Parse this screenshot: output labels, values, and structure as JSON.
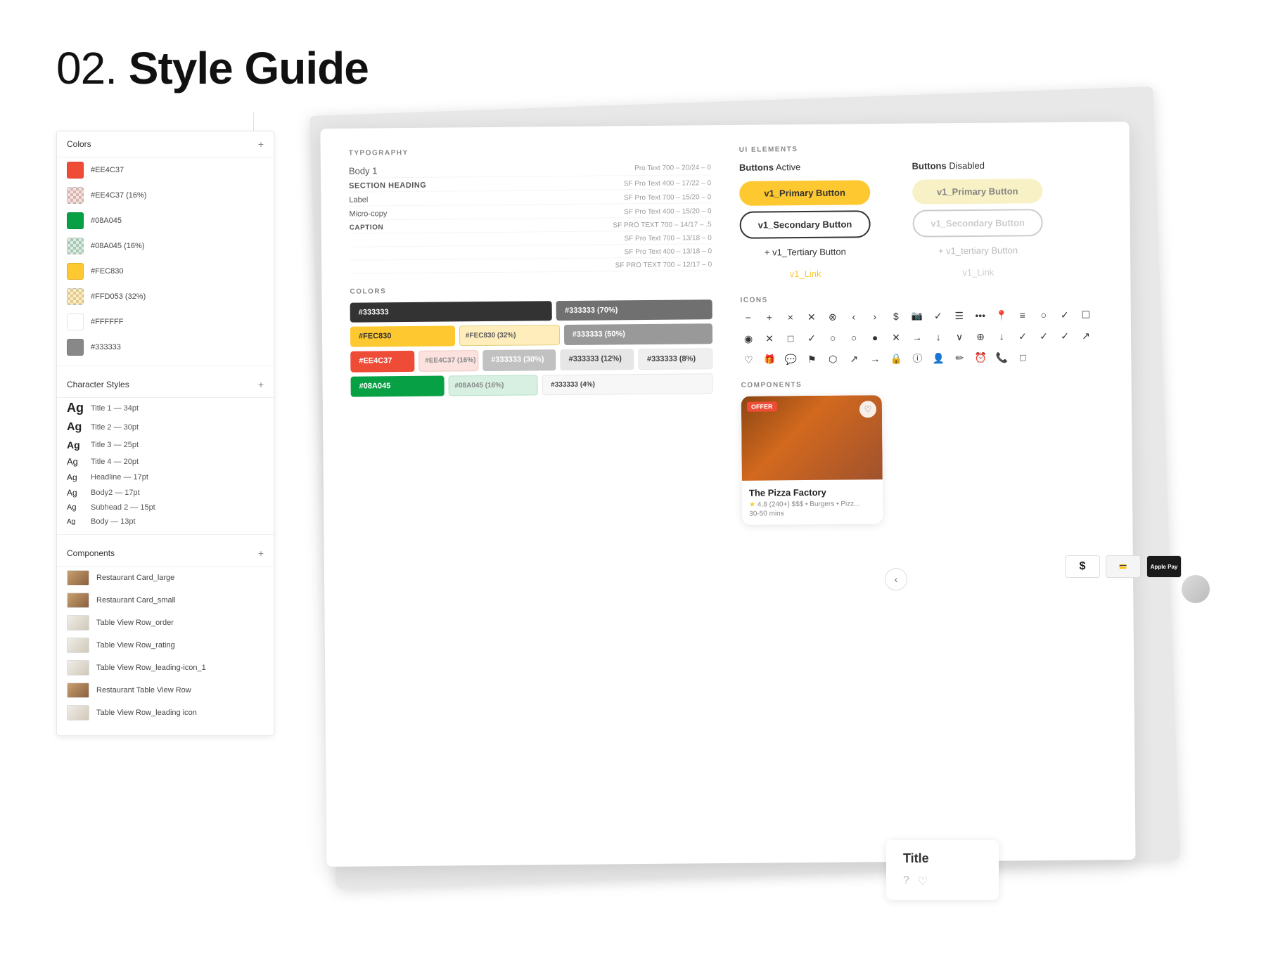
{
  "page": {
    "title": "Style Guide",
    "number": "02.",
    "background": "#f0f0f0"
  },
  "left_panel": {
    "colors_section": {
      "title": "Colors",
      "items": [
        {
          "hex": "#EE4C37",
          "label": "#EE4C37",
          "type": "solid"
        },
        {
          "hex": "#EE4C37",
          "label": "#EE4C37 (16%)",
          "type": "checkered"
        },
        {
          "hex": "#08A045",
          "label": "#08A045",
          "type": "solid"
        },
        {
          "hex": "#08A045",
          "label": "#08A045 (16%)",
          "type": "checkered"
        },
        {
          "hex": "#FEC830",
          "label": "#FEC830",
          "type": "solid"
        },
        {
          "hex": "#FFD053",
          "label": "#FFD053 (32%)",
          "type": "checkered"
        },
        {
          "hex": "#FFFFFF",
          "label": "#FFFFFF",
          "type": "solid"
        },
        {
          "hex": "#333333",
          "label": "#333333",
          "type": "solid"
        }
      ]
    },
    "character_styles_section": {
      "title": "Character Styles",
      "items": [
        {
          "sample": "Ag",
          "label": "Title 1 — 34pt"
        },
        {
          "sample": "Ag",
          "label": "Title 2 — 30pt"
        },
        {
          "sample": "Ag",
          "label": "Title 3 — 25pt"
        },
        {
          "sample": "Ag",
          "label": "Title 4 — 20pt"
        },
        {
          "sample": "Ag",
          "label": "Headline — 17pt"
        },
        {
          "sample": "Ag",
          "label": "Body2 — 17pt"
        },
        {
          "sample": "Ag",
          "label": "Subhead 2 — 15pt"
        },
        {
          "sample": "Ag",
          "label": "Body — 13pt"
        }
      ]
    },
    "components_section": {
      "title": "Components",
      "items": [
        {
          "label": "Restaurant Card_large",
          "type": "food"
        },
        {
          "label": "Restaurant Card_small",
          "type": "food"
        },
        {
          "label": "Table View Row_order",
          "type": "table"
        },
        {
          "label": "Table View Row_rating",
          "type": "table"
        },
        {
          "label": "Table View Row_leading-icon_1",
          "type": "table"
        },
        {
          "label": "Restaurant Table View Row",
          "type": "food"
        },
        {
          "label": "Table View Row_leading icon",
          "type": "table"
        }
      ]
    }
  },
  "style_guide": {
    "typography": {
      "title": "TYPOGRAPHY",
      "items": [
        {
          "label": "Body 1",
          "spec": "Pro Text 700 – 20/24 – 0"
        },
        {
          "label": "SECTION HEADING",
          "spec": "SF Pro Text 400 – 17/22 – 0"
        },
        {
          "label": "Label",
          "spec": "SF Pro Text 700 – 15/20 – 0"
        },
        {
          "label": "Micro-copy",
          "spec": "SF Pro Text 400 – 15/20 – 0"
        },
        {
          "label": "CAPTION",
          "spec": "SF PRO TEXT 700 – 14/17 – .5"
        },
        {
          "label": "",
          "spec": "SF Pro Text 700 – 13/18 – 0"
        },
        {
          "label": "",
          "spec": "SF Pro Text 400 – 13/18 – 0"
        },
        {
          "label": "",
          "spec": "SF PRO TEXT 700 – 12/17 – 0"
        }
      ]
    },
    "colors": {
      "title": "COLORS",
      "chips": [
        {
          "label": "#333333",
          "class": "dark"
        },
        {
          "label": "#333333 (70%)",
          "class": "gray70"
        },
        {
          "label": "#FEC830",
          "class": "yellow"
        },
        {
          "label": "#FEC830 (32%)",
          "class": "yellow-lt"
        },
        {
          "label": "#333333 (50%)",
          "class": "gray50"
        },
        {
          "label": "#EE4C37",
          "class": "orange"
        },
        {
          "label": "#EE4C37 (16%)",
          "class": "orange-lt"
        },
        {
          "label": "#333333 (30%)",
          "class": "gray30"
        },
        {
          "label": "#333333 (12%)",
          "class": "gray12"
        },
        {
          "label": "#08A045",
          "class": "green"
        },
        {
          "label": "#08A045 (16%)",
          "class": "green-lt"
        },
        {
          "label": "#333333 (8%)",
          "class": "gray8"
        },
        {
          "label": "#333333 (4%)",
          "class": "gray4"
        }
      ]
    },
    "ui_elements": {
      "title": "UI ELEMENTS",
      "buttons_active": {
        "title": "Buttons",
        "subtitle": "Active",
        "items": [
          {
            "label": "v1_Primary Button",
            "type": "primary"
          },
          {
            "label": "v1_Secondary Button",
            "type": "secondary"
          },
          {
            "label": "+ v1_Tertiary Button",
            "type": "tertiary"
          },
          {
            "label": "v1_Link",
            "type": "link"
          }
        ]
      },
      "buttons_disabled": {
        "title": "Buttons",
        "subtitle": "Disabled",
        "items": [
          {
            "label": "v1_Primary Button",
            "type": "primary"
          },
          {
            "label": "v1_Secondary Button",
            "type": "secondary"
          },
          {
            "label": "+ v1_tertiary Button",
            "type": "tertiary"
          },
          {
            "label": "v1_Link",
            "type": "link"
          }
        ]
      },
      "icons": {
        "title": "Icons",
        "symbols": [
          "−",
          "+",
          "×",
          "×",
          "⊗",
          "‹",
          "›",
          "$",
          "📷",
          "✓",
          "☰",
          "•••",
          "📍",
          "≡",
          "◯",
          "✓",
          "⬡",
          "◉",
          "✕",
          "◻",
          "✓",
          "◯",
          "◯",
          "◯",
          "•",
          "✕",
          "→",
          "↓",
          "∨",
          "⊕",
          "↓",
          "✓",
          "✓",
          "✓",
          "↗",
          "♡",
          "🎁",
          "💬",
          "🏳",
          "⬡",
          "↗",
          "→",
          "🔒",
          "ℹ",
          "👤",
          "✏",
          "⏰",
          "📞",
          "◻"
        ]
      }
    },
    "components": {
      "title": "Components",
      "restaurant_card": {
        "offer_badge": "OFFER",
        "name": "The Pizza Factory",
        "rating": "4.8 (240+)",
        "price": "$$$",
        "cuisine": "Burgers • Pizz...",
        "time": "30-50 mins"
      }
    }
  },
  "right_panel": {
    "title": "Title"
  },
  "bottom_nav": {
    "arrow_label": "‹"
  },
  "payment_methods": [
    "$",
    "💳",
    "Apple Pay"
  ]
}
